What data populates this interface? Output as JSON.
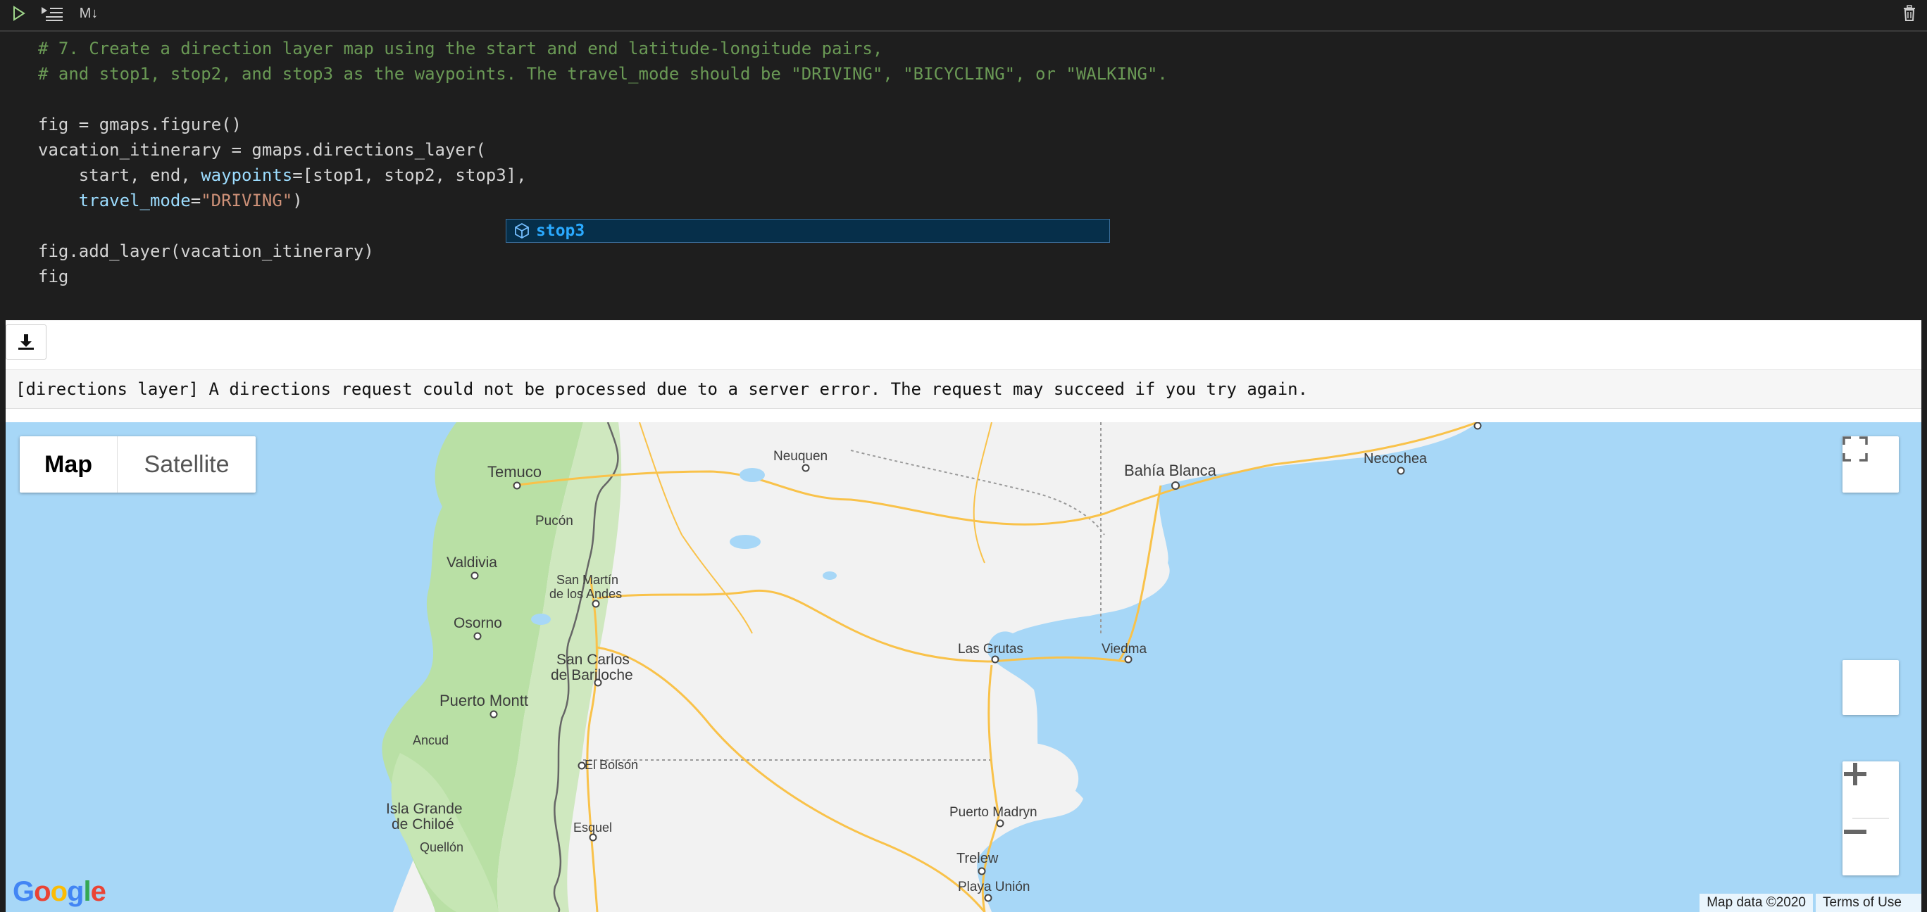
{
  "toolbar": {
    "run_icon": "play-icon",
    "run_all_icon": "run-below-icon",
    "markdown_label": "M↓",
    "delete_icon": "trash-icon"
  },
  "code": {
    "line1": "# 7. Create a direction layer map using the start and end latitude-longitude pairs,",
    "line2": "# and stop1, stop2, and stop3 as the waypoints. The travel_mode should be \"DRIVING\", \"BICYCLING\", or \"WALKING\".",
    "line4": "fig = gmaps.figure()",
    "line5": "vacation_itinerary = gmaps.directions_layer(",
    "line6_a": "    start, end, ",
    "line6_kw": "waypoints",
    "line6_b": "=[stop1, stop2, stop3],",
    "line7_a": "    ",
    "line7_kw": "travel_mode",
    "line7_eq": "=",
    "line7_str": "\"DRIVING\"",
    "line7_b": ")",
    "line9": "fig.add_layer(vacation_itinerary)",
    "line10": "fig"
  },
  "suggestion": {
    "icon": "variable-cube-icon",
    "label": "stop3"
  },
  "output": {
    "download_icon": "download-icon",
    "error_message": "[directions layer] A directions request could not be processed due to a server error. The request may succeed if you try again."
  },
  "map": {
    "type_map": "Map",
    "type_satellite": "Satellite",
    "attribution": "Map data ©2020",
    "terms": "Terms of Use",
    "logo": "Google",
    "places": {
      "temuco": "Temuco",
      "pucon": "Pucón",
      "valdivia": "Valdivia",
      "osorno": "Osorno",
      "puerto_montt": "Puerto Montt",
      "ancud": "Ancud",
      "isla_grande_1": "Isla Grande",
      "isla_grande_2": "de Chiloé",
      "quellon": "Quellón",
      "san_martin_1": "San Martín",
      "san_martin_2": "de los Andes",
      "san_carlos_1": "San Carlos",
      "san_carlos_2": "de Bariloche",
      "el_bolson": "El Bolsón",
      "esquel": "Esquel",
      "neuquen": "Neuquen",
      "bahia_blanca": "Bahía Blanca",
      "necochea": "Necochea",
      "las_grutas": "Las Grutas",
      "viedma": "Viedma",
      "puerto_madryn": "Puerto Madryn",
      "trelew": "Trelew",
      "playa_union": "Playa Unión"
    }
  },
  "colors": {
    "comment": "#6a9955",
    "keyword": "#9cdcfe",
    "string": "#ce9178",
    "land": "#f2f2f2",
    "water": "#a7d7f7",
    "forest": "#b9e0a5",
    "road": "#f9c24a"
  }
}
